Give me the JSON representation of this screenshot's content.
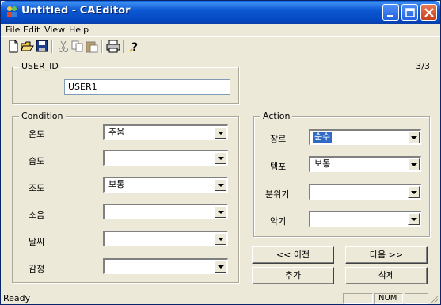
{
  "window": {
    "title": "Untitled - CAEditor"
  },
  "menu": {
    "items": [
      {
        "label": "File"
      },
      {
        "label": "Edit"
      },
      {
        "label": "View"
      },
      {
        "label": "Help"
      }
    ]
  },
  "toolbar": {
    "icons": [
      "new-icon",
      "open-icon",
      "save-icon",
      "cut-icon",
      "copy-icon",
      "paste-icon",
      "print-icon",
      "help-icon"
    ]
  },
  "user": {
    "group_title": "USER_ID",
    "id_value": "USER1",
    "record_counter": "3/3"
  },
  "condition": {
    "group_title": "Condition",
    "fields": [
      {
        "label": "온도",
        "value": "추움"
      },
      {
        "label": "습도",
        "value": ""
      },
      {
        "label": "조도",
        "value": "보통"
      },
      {
        "label": "소음",
        "value": ""
      },
      {
        "label": "날씨",
        "value": ""
      },
      {
        "label": "감정",
        "value": ""
      }
    ]
  },
  "action": {
    "group_title": "Action",
    "fields": [
      {
        "label": "장르",
        "value": "순수",
        "selected": true
      },
      {
        "label": "템포",
        "value": "보통"
      },
      {
        "label": "분위기",
        "value": ""
      },
      {
        "label": "악기",
        "value": ""
      }
    ]
  },
  "buttons": {
    "prev": "<< 이전",
    "next": "다음 >>",
    "add": "추가",
    "delete": "삭제"
  },
  "status": {
    "text": "Ready",
    "num": "NUM"
  },
  "colors": {
    "titlebar": "#0d58d3",
    "selection": "#316ac5",
    "face": "#ece9d8"
  }
}
